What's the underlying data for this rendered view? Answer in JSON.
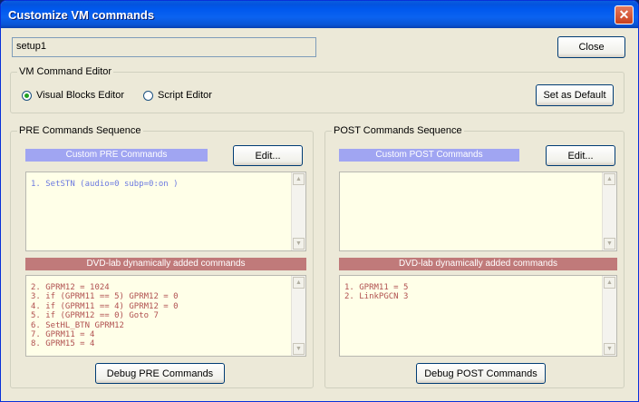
{
  "window": {
    "title": "Customize VM commands",
    "close_glyph": "✕"
  },
  "top": {
    "name_value": "setup1",
    "close_label": "Close"
  },
  "editor": {
    "legend": "VM Command Editor",
    "radio_visual": "Visual Blocks Editor",
    "radio_script": "Script Editor",
    "selected": "visual",
    "set_default_label": "Set as Default"
  },
  "pre": {
    "legend": "PRE Commands Sequence",
    "custom_header": "Custom PRE Commands",
    "edit_label": "Edit...",
    "custom_lines": [
      "1. SetSTN (audio=0 subp=0:on )"
    ],
    "dyn_header": "DVD-lab dynamically added commands",
    "dyn_lines": [
      "2. GPRM12 = 1024",
      "3. if (GPRM11 == 5) GPRM12 = 0",
      "4. if (GPRM11 == 4) GPRM12 = 0",
      "5. if (GPRM12 == 0) Goto 7",
      "6. SetHL_BTN GPRM12",
      "7. GPRM11 = 4",
      "8. GPRM15 = 4"
    ],
    "debug_label": "Debug PRE Commands"
  },
  "post": {
    "legend": "POST Commands Sequence",
    "custom_header": "Custom POST Commands",
    "edit_label": "Edit...",
    "custom_lines": [],
    "dyn_header": "DVD-lab dynamically added commands",
    "dyn_lines": [
      "1. GPRM11 = 5",
      "2. LinkPGCN 3"
    ],
    "debug_label": "Debug POST Commands"
  },
  "scroll": {
    "up_glyph": "▲",
    "down_glyph": "▼"
  },
  "colors": {
    "custom_header_bg": "#a0a5f2",
    "dyn_header_bg": "#c07a7a",
    "memo_bg": "#ffffe8",
    "custom_text": "#6c7ae0",
    "dyn_text": "#b05050"
  }
}
